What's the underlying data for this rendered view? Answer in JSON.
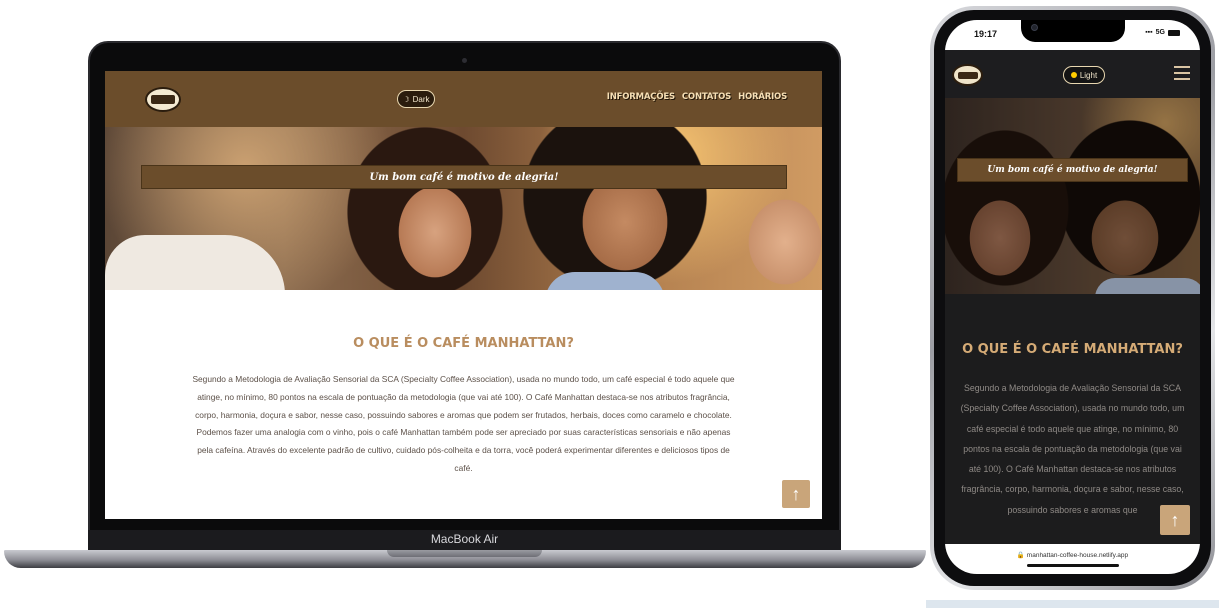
{
  "desktop": {
    "device_label": "MacBook Air",
    "theme_toggle": {
      "icon": "moon-icon",
      "label": "Dark"
    },
    "nav": [
      {
        "label": "INFORMAÇÕES"
      },
      {
        "label": "CONTATOS"
      },
      {
        "label": "HORÁRIOS"
      }
    ],
    "hero_banner": "Um bom café é motivo de alegria!",
    "section_title": "O QUE É O CAFÉ MANHATTAN?",
    "body_text": "Segundo a Metodologia de Avaliação Sensorial da SCA (Specialty Coffee Association), usada no mundo todo, um café especial é todo aquele que atinge, no mínimo, 80 pontos na escala de pontuação da metodologia (que vai até 100). O Café Manhattan destaca-se nos atributos fragrância, corpo, harmonia, doçura e sabor, nesse caso, possuindo sabores e aromas que podem ser frutados, herbais, doces como caramelo e chocolate. Podemos fazer uma analogia com o vinho, pois o café Manhattan também pode ser apreciado por suas características sensoriais e não apenas pela cafeína. Através do excelente padrão de cultivo, cuidado pós-colheita e da torra, você poderá experimentar diferentes e deliciosos tipos de café.",
    "back_to_top_icon": "arrow-up-icon"
  },
  "mobile": {
    "status": {
      "time": "19:17",
      "network": "5G"
    },
    "theme_toggle": {
      "icon": "sun-icon",
      "label": "Light"
    },
    "menu_icon": "hamburger-menu-icon",
    "hero_banner": "Um bom café é motivo de alegria!",
    "section_title": "O QUE É O CAFÉ MANHATTAN?",
    "body_text": "Segundo a Metodologia de Avaliação Sensorial da SCA (Specialty Coffee Association), usada no mundo todo, um café especial é todo aquele que atinge, no mínimo, 80 pontos na escala de pontuação da metodologia (que vai até 100). O Café Manhattan destaca-se nos atributos fragrância, corpo, harmonia, doçura e sabor, nesse caso, possuindo sabores e aromas que",
    "url": "manhattan-coffee-house.netlify.app",
    "back_to_top_icon": "arrow-up-icon"
  },
  "colors": {
    "header_brown": "#6b4d2b",
    "title_gold": "#b98d5f",
    "back_to_top": "#c9a57a",
    "dark_bg": "#1c1c1d"
  }
}
